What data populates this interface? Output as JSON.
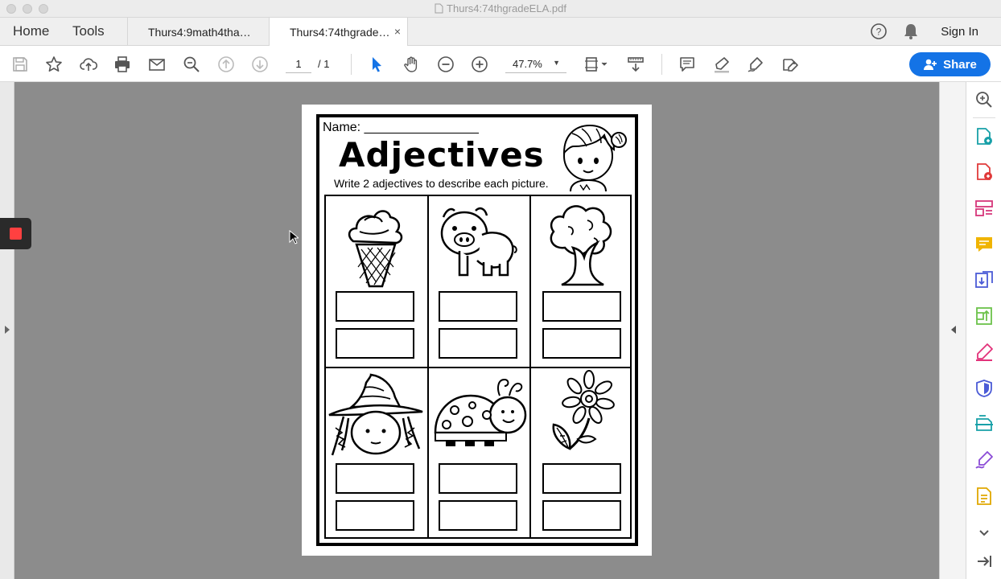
{
  "window": {
    "title": "Thurs4:74thgradeELA.pdf"
  },
  "nav": {
    "home": "Home",
    "tools": "Tools"
  },
  "tabs": [
    {
      "label": "Thurs4:9math4tha…"
    },
    {
      "label": "Thurs4:74thgrade…",
      "close": "×"
    }
  ],
  "account": {
    "sign_in": "Sign In"
  },
  "toolbar": {
    "page_current": "1",
    "page_total": "/ 1",
    "zoom": "47.7%",
    "share_label": "Share",
    "icons": [
      "save-icon",
      "star-icon",
      "upload-icon",
      "print-icon",
      "mail-icon",
      "zoom-search-icon",
      "page-up-icon",
      "page-down-icon",
      "select-arrow-icon",
      "hand-icon",
      "zoom-out-icon",
      "zoom-in-icon",
      "fit-page-icon",
      "scroll-mode-icon",
      "comment-icon",
      "highlight-icon",
      "sign-icon",
      "fill-sign-icon"
    ]
  },
  "right_panel": {
    "icons": [
      "zoom-panel-icon",
      "create-pdf-icon",
      "combine-icon",
      "organize-icon",
      "comment-tool-icon",
      "export-icon",
      "compress-icon",
      "edit-icon",
      "protect-icon",
      "scan-icon",
      "fill-sign-tool-icon",
      "more-tools-icon",
      "expand-down-icon",
      "collapse-panel-icon"
    ]
  },
  "worksheet": {
    "name_label": "Name: ________________",
    "title": "Adjectives",
    "instruction": "Write 2 adjectives to describe each picture.",
    "pictures": [
      "ice-cream",
      "pig",
      "tree",
      "witch",
      "ladybug",
      "flower"
    ]
  },
  "colors": {
    "accent": "#1473e6",
    "doc_background": "#8c8c8c"
  }
}
